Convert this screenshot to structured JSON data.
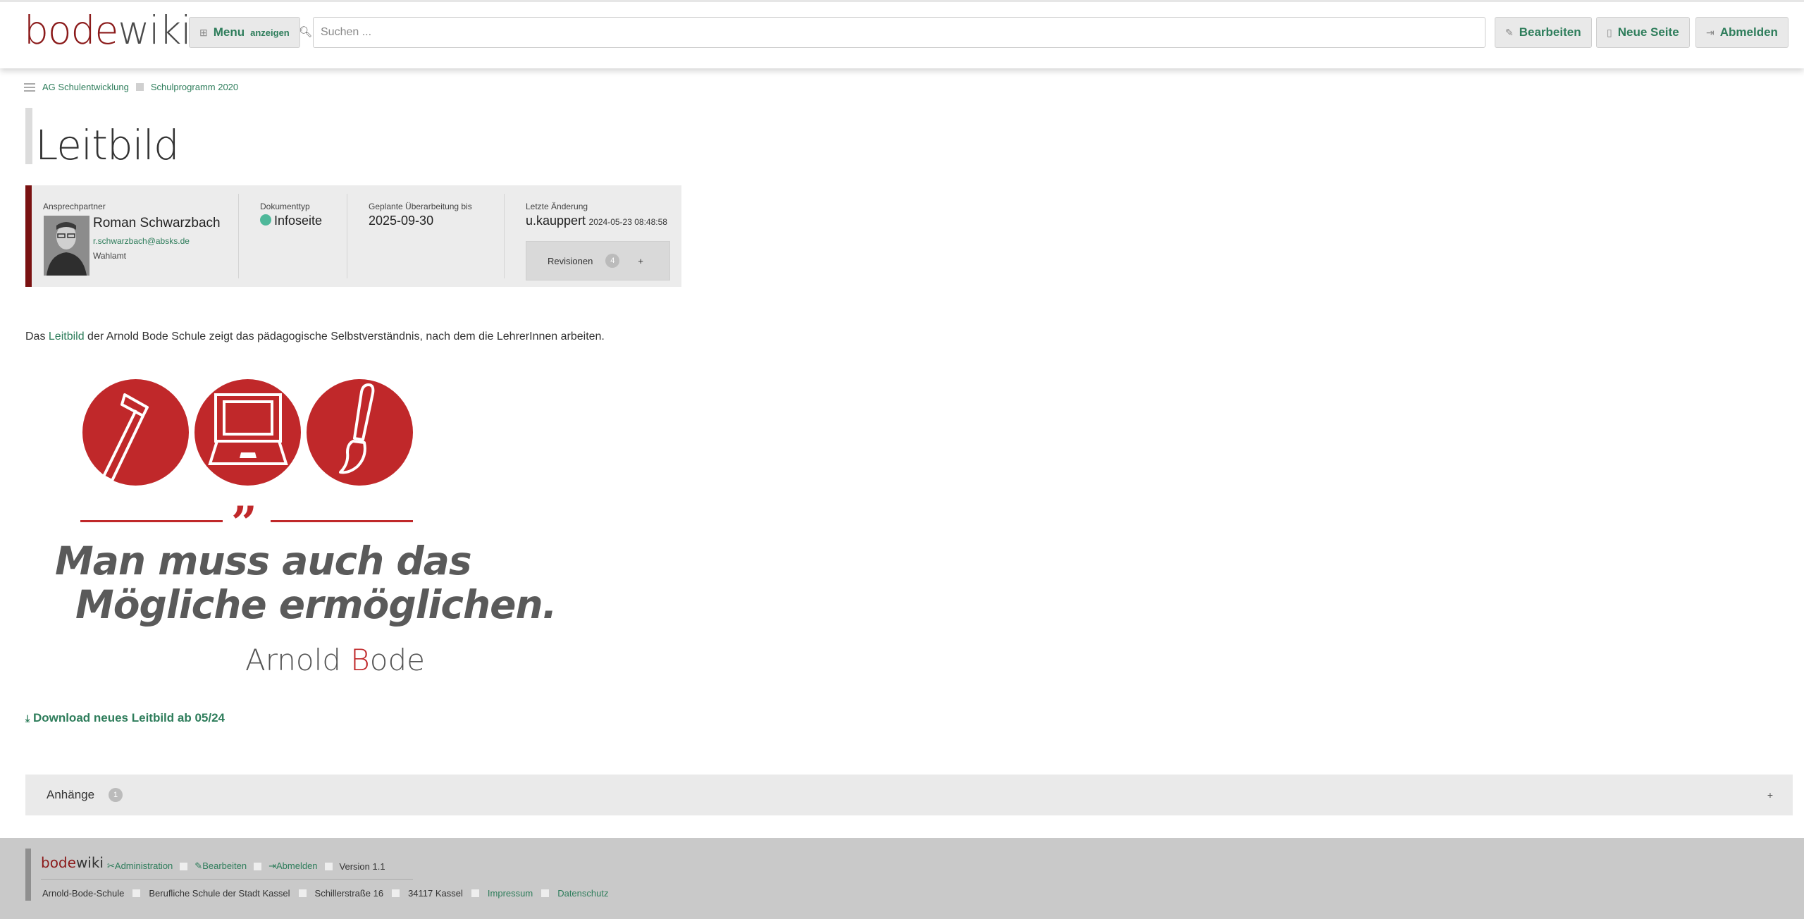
{
  "header": {
    "logo_part1": "bode",
    "logo_part2": "wiki",
    "menu_label": "Menu",
    "menu_small": "anzeigen",
    "search_placeholder": "Suchen ...",
    "edit_label": "Bearbeiten",
    "new_page_label": "Neue Seite",
    "logout_label": "Abmelden"
  },
  "breadcrumb": {
    "items": [
      "AG Schulentwicklung",
      "Schulprogramm 2020"
    ]
  },
  "page": {
    "title": "Leitbild"
  },
  "info": {
    "contact_label": "Ansprechpartner",
    "contact_name": "Roman Schwarzbach",
    "contact_email": "r.schwarzbach@absks.de",
    "contact_role": "Wahlamt",
    "doctype_label": "Dokumenttyp",
    "doctype_value": "Infoseite",
    "review_label": "Geplante Überarbeitung bis",
    "review_value": "2025-09-30",
    "change_label": "Letzte Änderung",
    "change_user": "u.kauppert",
    "change_date": "2024-05-23 08:48:58",
    "revisions_label": "Revisionen",
    "revisions_count": "4",
    "revisions_plus": "+"
  },
  "content": {
    "intro_before": "Das ",
    "intro_link": "Leitbild",
    "intro_after": " der Arnold Bode Schule zeigt das pädagogische Selbstverständnis, nach dem die LehrerInnen arbeiten.",
    "quote_mark": "”",
    "quote_line1": "Man muss auch das",
    "quote_line2": "Mögliche ermöglichen.",
    "author_a": "Arnold ",
    "author_b": "B",
    "author_c": "ode",
    "download_label": "Download neues Leitbild ab 05/24"
  },
  "attachments": {
    "label": "Anhänge",
    "count": "1",
    "plus": "+"
  },
  "footer": {
    "logo_part1": "bode",
    "logo_part2": "wiki",
    "links": [
      "Administration",
      "Bearbeiten",
      "Abmelden"
    ],
    "version": "Version 1.1",
    "address": [
      "Arnold-Bode-Schule",
      "Berufliche Schule der Stadt Kassel",
      "Schillerstraße 16",
      "34117 Kassel"
    ],
    "impressum": "Impressum",
    "datenschutz": "Datenschutz"
  },
  "colors": {
    "brand_red": "#8b1a1a",
    "accent_green": "#2e7d5b",
    "leitbild_red": "#c0282a"
  }
}
